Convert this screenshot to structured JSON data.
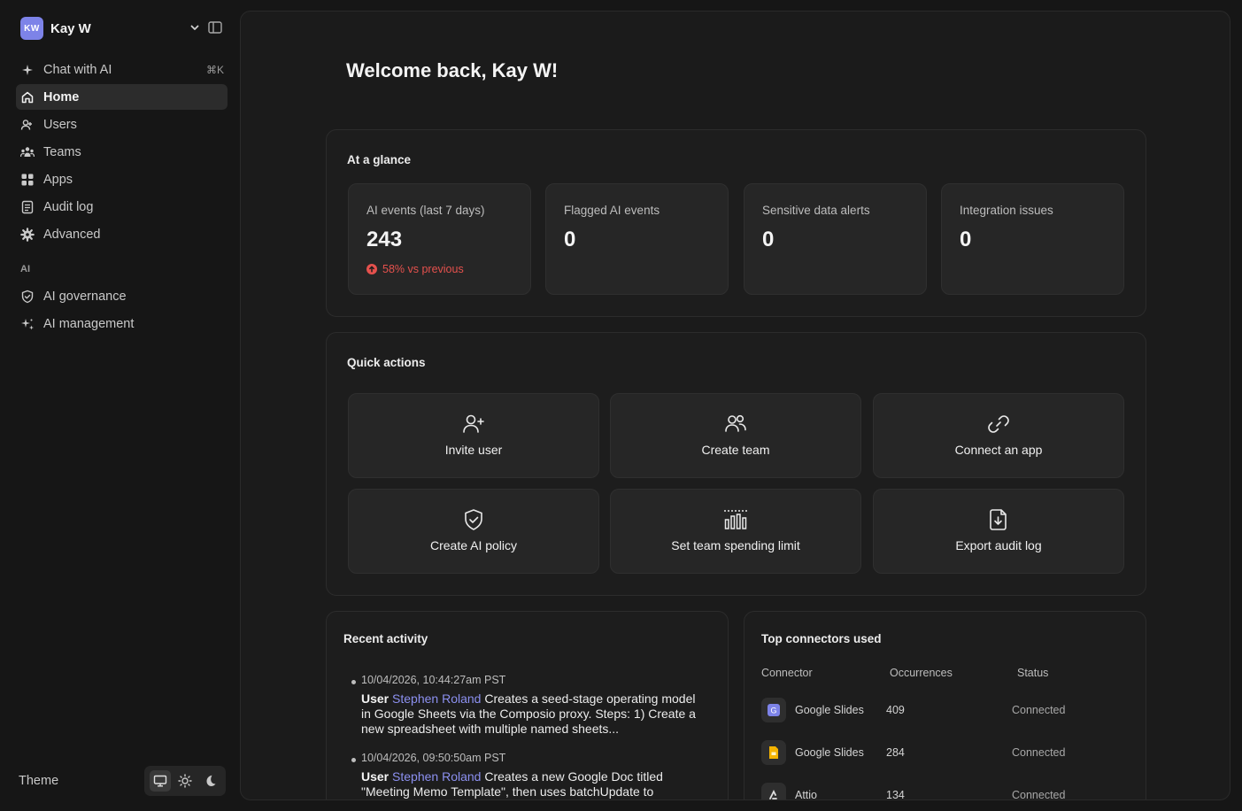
{
  "account": {
    "initials": "KW",
    "name": "Kay W"
  },
  "sidebar": {
    "chat": {
      "label": "Chat with AI",
      "shortcut": "⌘K"
    },
    "items": [
      {
        "label": "Home",
        "icon": "home-icon",
        "active": true
      },
      {
        "label": "Users",
        "icon": "users-icon"
      },
      {
        "label": "Teams",
        "icon": "teams-icon"
      },
      {
        "label": "Apps",
        "icon": "apps-grid-icon"
      },
      {
        "label": "Audit log",
        "icon": "document-icon"
      },
      {
        "label": "Advanced",
        "icon": "gear-icon"
      }
    ],
    "section_label": "AI",
    "ai_items": [
      {
        "label": "AI governance",
        "icon": "shield-check-icon"
      },
      {
        "label": "AI management",
        "icon": "sparkle-icon"
      }
    ],
    "theme_label": "Theme"
  },
  "main": {
    "welcome": "Welcome back, Kay W!",
    "glance": {
      "title": "At a glance",
      "stats": [
        {
          "label": "AI events (last 7 days)",
          "value": "243",
          "delta": "58% vs previous"
        },
        {
          "label": "Flagged AI events",
          "value": "0"
        },
        {
          "label": "Sensitive data alerts",
          "value": "0"
        },
        {
          "label": "Integration issues",
          "value": "0"
        }
      ]
    },
    "quick_actions": {
      "title": "Quick actions",
      "actions": [
        {
          "label": "Invite user",
          "icon": "user-plus-icon"
        },
        {
          "label": "Create team",
          "icon": "team-icon"
        },
        {
          "label": "Connect an app",
          "icon": "link-icon"
        },
        {
          "label": "Create AI policy",
          "icon": "shield-check-icon"
        },
        {
          "label": "Set team spending limit",
          "icon": "bar-chart-icon"
        },
        {
          "label": "Export audit log",
          "icon": "file-download-icon"
        }
      ]
    },
    "recent_activity": {
      "title": "Recent activity",
      "items": [
        {
          "timestamp": "10/04/2026, 10:44:27am PST",
          "prefix": "User",
          "user": "Stephen Roland",
          "text": "Creates a seed-stage operating model in Google Sheets via the Composio proxy. Steps: 1) Create a new spreadsheet with multiple named sheets..."
        },
        {
          "timestamp": "10/04/2026, 09:50:50am PST",
          "prefix": "User",
          "user": "Stephen Roland",
          "text": "Creates a new Google Doc titled \"Meeting Memo Template\", then uses batchUpdate to"
        }
      ]
    },
    "top_connectors": {
      "title": "Top connectors used",
      "headers": {
        "connector": "Connector",
        "occurrences": "Occurrences",
        "status": "Status"
      },
      "rows": [
        {
          "name": "Google Slides",
          "occurrences": "409",
          "status": "Connected",
          "icon": "google-slides-g-icon",
          "icon_color": "#7d83e8"
        },
        {
          "name": "Google Slides",
          "occurrences": "284",
          "status": "Connected",
          "icon": "google-slides-doc-icon",
          "icon_color": "#f5b400"
        },
        {
          "name": "Attio",
          "occurrences": "134",
          "status": "Connected",
          "icon": "attio-icon",
          "icon_color": "#e0e0e0"
        }
      ]
    }
  },
  "colors": {
    "accent": "#7d83e8",
    "danger": "#e5514d",
    "link": "#8c90f0"
  }
}
